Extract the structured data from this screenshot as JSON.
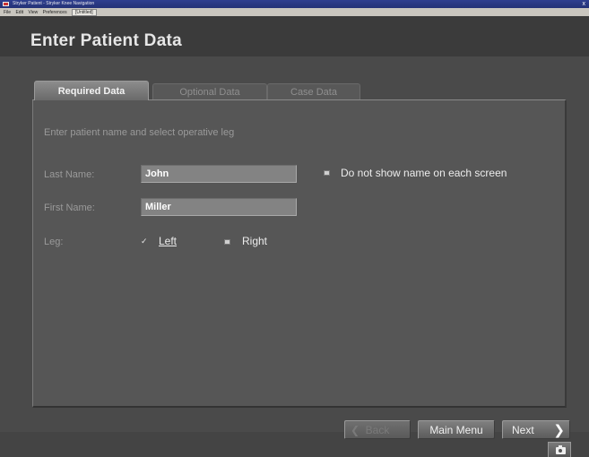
{
  "window": {
    "title": "Stryker Patient - Stryker Knee Navigation",
    "menu": [
      "File",
      "Edit",
      "View",
      "Preferences"
    ],
    "menu_tab": "[Untitled]",
    "close_glyph": "x"
  },
  "header": {
    "title": "Enter Patient Data"
  },
  "tabs": [
    {
      "label": "Required Data",
      "active": true
    },
    {
      "label": "Optional Data",
      "active": false
    },
    {
      "label": "Case Data",
      "active": false
    }
  ],
  "form": {
    "instruction": "Enter patient name and select operative leg",
    "last_name": {
      "label": "Last Name:",
      "value": "John"
    },
    "first_name": {
      "label": "First Name:",
      "value": "Miller"
    },
    "hide_name": {
      "label": "Do not show name on each screen",
      "checked": false
    },
    "leg": {
      "label": "Leg:",
      "options": [
        {
          "label": "Left",
          "selected": true
        },
        {
          "label": "Right",
          "selected": false
        }
      ]
    }
  },
  "footer": {
    "back_label": "Back",
    "main_menu_label": "Main Menu",
    "next_label": "Next",
    "back_icon": "chevron-left-icon",
    "next_icon": "chevron-right-icon",
    "camera_icon": "camera-icon"
  },
  "colors": {
    "background": "#4a4a4a",
    "panel": "#565656",
    "input": "#838383",
    "text": "#ececec",
    "muted_text": "#9a9a9a"
  }
}
